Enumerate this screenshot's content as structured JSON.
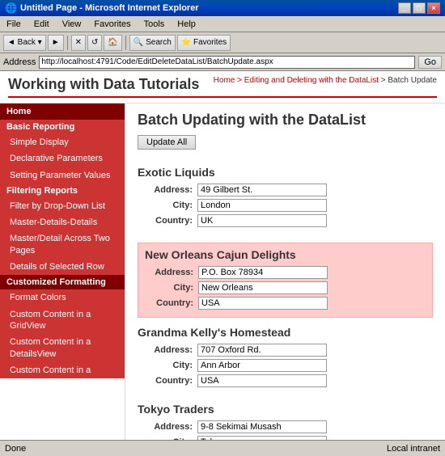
{
  "window": {
    "title": "Untitled Page - Microsoft Internet Explorer",
    "controls": [
      "_",
      "□",
      "×"
    ]
  },
  "menu": {
    "items": [
      "File",
      "Edit",
      "View",
      "Favorites",
      "Tools",
      "Help"
    ]
  },
  "toolbar": {
    "back_label": "◄ Back",
    "forward_label": "►",
    "stop_label": "✕",
    "refresh_label": "↺",
    "home_label": "🏠",
    "search_label": "Search",
    "favorites_label": "Favorites"
  },
  "address": {
    "label": "Address",
    "url": "http://localhost:4791/Code/EditDeleteDataList/BatchUpdate.aspx",
    "go_label": "Go"
  },
  "page_header": {
    "title": "Working with Data Tutorials",
    "breadcrumb_home": "Home",
    "breadcrumb_section": "Editing and Deleting with the DataList",
    "breadcrumb_current": "Batch Update"
  },
  "sidebar": {
    "home_label": "Home",
    "sections": [
      {
        "label": "Basic Reporting",
        "items": [
          "Simple Display",
          "Declarative Parameters",
          "Setting Parameter Values"
        ]
      },
      {
        "label": "Filtering Reports",
        "items": [
          "Filter by Drop-Down List",
          "Master-Details-Details",
          "Master/Detail Across Two Pages",
          "Details of Selected Row"
        ]
      },
      {
        "label": "Customized Formatting",
        "items": [
          "Format Colors",
          "Custom Content in a GridView",
          "Custom Content in a DetailsView",
          "Custom Content in a"
        ]
      }
    ]
  },
  "content": {
    "title": "Batch Updating with the DataList",
    "update_all_label": "Update All",
    "companies": [
      {
        "name": "Exotic Liquids",
        "highlighted": false,
        "address": "49 Gilbert St.",
        "city": "London",
        "country": "UK"
      },
      {
        "name": "New Orleans Cajun Delights",
        "highlighted": true,
        "address": "P.O. Box 78934",
        "city": "New Orleans",
        "country": "USA"
      },
      {
        "name": "Grandma Kelly's Homestead",
        "highlighted": false,
        "address": "707 Oxford Rd.",
        "city": "Ann Arbor",
        "country": "USA"
      },
      {
        "name": "Tokyo Traders",
        "highlighted": false,
        "address": "9-8 Sekimai Musash",
        "city": "Tokyo",
        "country": ""
      }
    ],
    "field_labels": {
      "address": "Address:",
      "city": "City:",
      "country": "Country:"
    }
  },
  "status": {
    "left": "Done",
    "right": "Local intranet"
  },
  "colors": {
    "sidebar_dark": "#800000",
    "sidebar_medium": "#cc3333",
    "highlight_bg": "#ffcccc",
    "breadcrumb": "#cc0000",
    "header_line": "#cc0000"
  }
}
